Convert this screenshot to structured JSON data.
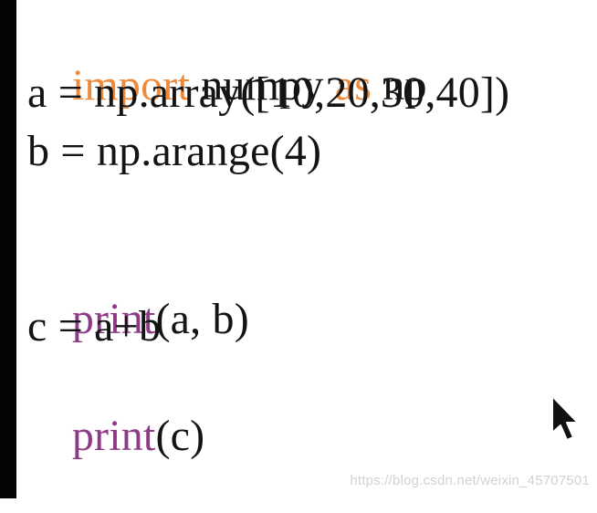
{
  "code": {
    "line1": {
      "import_kw": "import",
      "module": " numpy ",
      "as_kw": "as",
      "alias": " np"
    },
    "line2": "a = np.array([10,20,30,40])",
    "line3": "b = np.arange(4)",
    "line4": "",
    "line5": {
      "print_kw": "print",
      "args": "(a, b)"
    },
    "line6": "c = a+b",
    "line7": {
      "print_kw": "print",
      "args": "(c)"
    }
  },
  "watermark": {
    "text": "https://blog.csdn.net/weixin_45707501"
  },
  "icons": {
    "cursor": "mouse-pointer-icon"
  },
  "colors": {
    "keyword_import": "#ef8a3a",
    "keyword_print": "#8f3a86",
    "text": "#141414",
    "background": "#ffffff",
    "left_bar": "#050505",
    "watermark": "#d2d2d2"
  }
}
